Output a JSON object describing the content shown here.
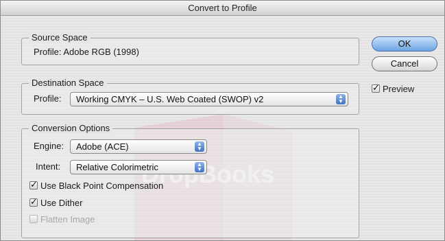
{
  "window": {
    "title": "Convert to Profile"
  },
  "source_space": {
    "legend": "Source Space",
    "profile_text": "Profile:  Adobe RGB (1998)"
  },
  "destination_space": {
    "legend": "Destination Space",
    "profile_label": "Profile:",
    "profile_value": "Working CMYK – U.S. Web Coated (SWOP) v2"
  },
  "conversion_options": {
    "legend": "Conversion Options",
    "engine_label": "Engine:",
    "engine_value": "Adobe (ACE)",
    "intent_label": "Intent:",
    "intent_value": "Relative Colorimetric",
    "black_point_label": "Use Black Point Compensation",
    "black_point_checked": true,
    "dither_label": "Use Dither",
    "dither_checked": true,
    "flatten_label": "Flatten Image",
    "flatten_checked": false,
    "flatten_enabled": false
  },
  "buttons": {
    "ok_label": "OK",
    "cancel_label": "Cancel"
  },
  "preview": {
    "label": "Preview",
    "checked": true
  },
  "watermark": {
    "text": "DropBooks"
  },
  "icons": {
    "popup_arrows": "updown-arrows-icon",
    "checkmark": "checkmark-icon"
  },
  "colors": {
    "accent": "#5b8fd6",
    "watermark": "#e38a9a"
  }
}
